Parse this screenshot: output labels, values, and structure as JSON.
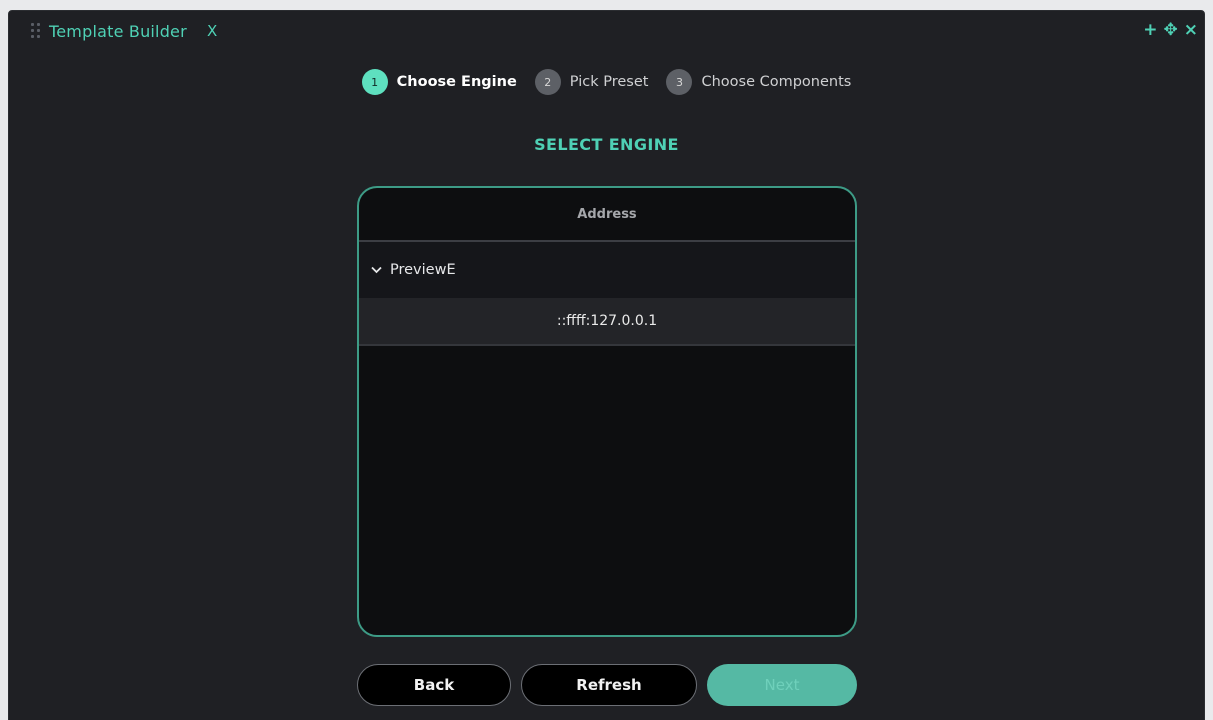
{
  "window": {
    "tab_title": "Template Builder",
    "tab_close": "X",
    "controls": {
      "add": "+",
      "move": "✥",
      "close": "×"
    }
  },
  "steps": [
    {
      "number": "1",
      "label": "Choose Engine",
      "active": true
    },
    {
      "number": "2",
      "label": "Pick Preset",
      "active": false
    },
    {
      "number": "3",
      "label": "Choose Components",
      "active": false
    }
  ],
  "section_title": "SELECT ENGINE",
  "table": {
    "column_header": "Address",
    "group": {
      "label": "PreviewE",
      "expanded": true
    },
    "rows": [
      {
        "address": "::ffff:127.0.0.1"
      }
    ]
  },
  "buttons": {
    "back": "Back",
    "refresh": "Refresh",
    "next": "Next"
  },
  "colors": {
    "accent": "#4fd1b5",
    "active_step": "#5ee0bf",
    "next_button": "#55b9a4",
    "panel_bg": "#1f2024"
  }
}
